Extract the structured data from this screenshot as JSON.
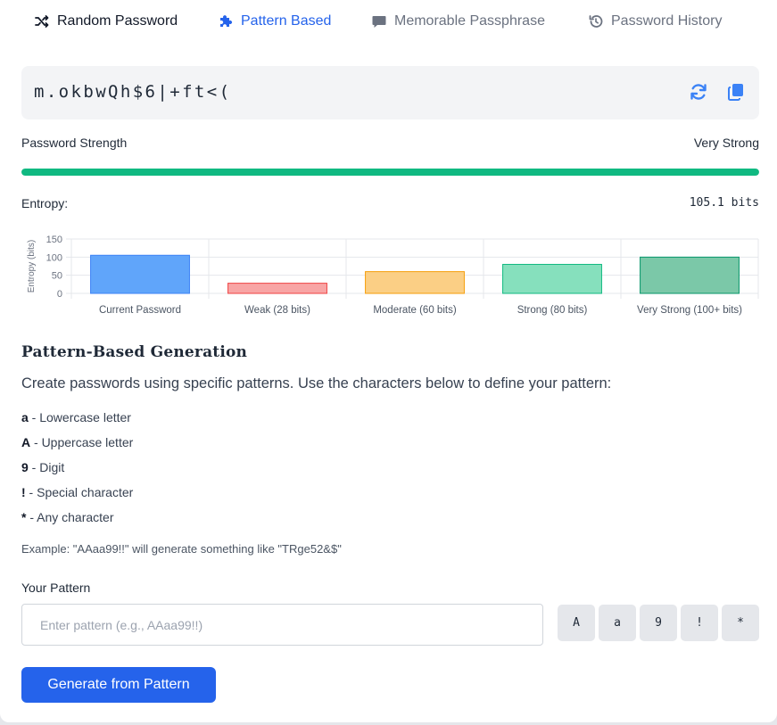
{
  "tabs": [
    {
      "label": "Random Password",
      "icon": "shuffle-icon"
    },
    {
      "label": "Pattern Based",
      "icon": "puzzle-icon"
    },
    {
      "label": "Memorable Passphrase",
      "icon": "comment-icon"
    },
    {
      "label": "Password History",
      "icon": "history-icon"
    }
  ],
  "password": {
    "value": "m.okbwQh$6|+ft<(",
    "refresh_icon": "refresh-icon",
    "copy_icon": "copy-icon"
  },
  "strength": {
    "label": "Password Strength",
    "value": "Very Strong",
    "level_percent": 100,
    "color": "#10b981"
  },
  "entropy": {
    "label": "Entropy:",
    "value": "105.1 bits"
  },
  "chart_data": {
    "type": "bar",
    "categories": [
      "Current Password",
      "Weak (28 bits)",
      "Moderate (60 bits)",
      "Strong (80 bits)",
      "Very Strong (100+ bits)"
    ],
    "values": [
      105.1,
      28,
      60,
      80,
      100
    ],
    "colors": [
      "#60a5fa",
      "#f8a5a5",
      "#fbcf85",
      "#86e0bd",
      "#7bc8a8"
    ],
    "borders": [
      "#3b82f6",
      "#ef4444",
      "#f59e0b",
      "#10b981",
      "#059669"
    ],
    "ylabel": "Entropy (bits)",
    "yticks": [
      0,
      50,
      100,
      150
    ],
    "ylim": [
      0,
      150
    ],
    "grid": true
  },
  "section": {
    "title": "Pattern-Based Generation",
    "description": "Create passwords using specific patterns. Use the characters below to define your pattern:",
    "legend": [
      {
        "key": "a",
        "text": " - Lowercase letter"
      },
      {
        "key": "A",
        "text": " - Uppercase letter"
      },
      {
        "key": "9",
        "text": " - Digit"
      },
      {
        "key": "!",
        "text": " - Special character"
      },
      {
        "key": "*",
        "text": " - Any character"
      }
    ],
    "example": "Example: \"AAaa99!!\" will generate something like \"TRge52&$\""
  },
  "pattern": {
    "label": "Your Pattern",
    "value": "",
    "placeholder": "Enter pattern (e.g., AAaa99!!)",
    "chips": [
      "A",
      "a",
      "9",
      "!",
      "*"
    ]
  },
  "generate_button": "Generate from Pattern",
  "accent": "#2563eb"
}
